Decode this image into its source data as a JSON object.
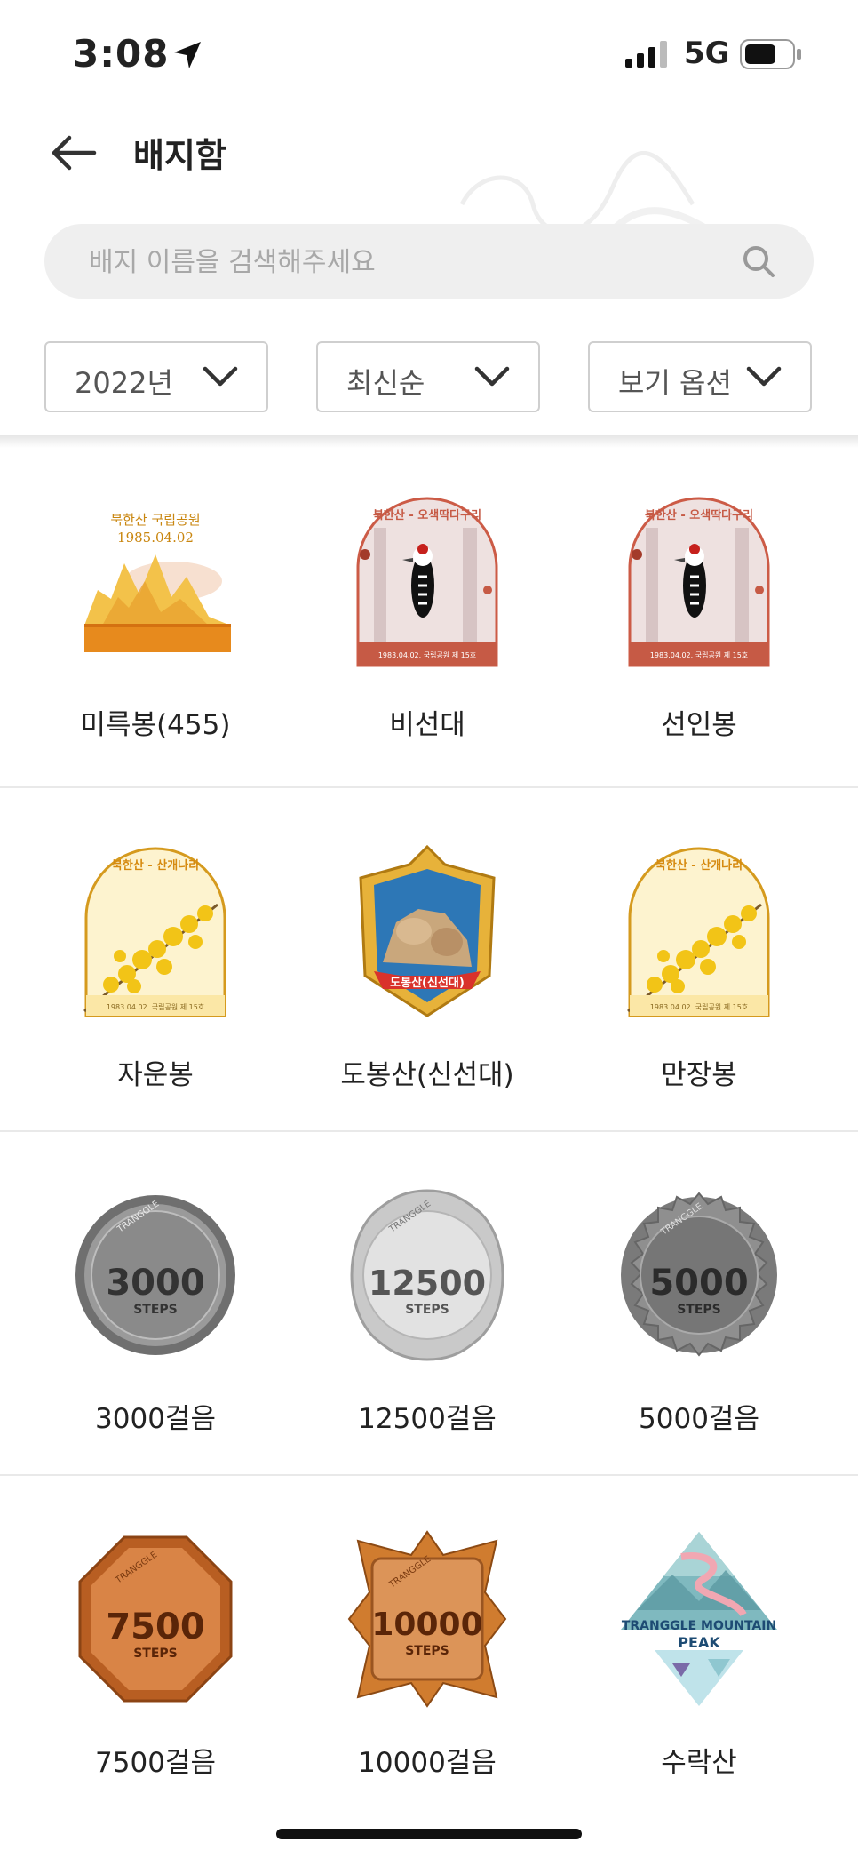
{
  "status": {
    "time": "3:08",
    "network": "5G"
  },
  "header": {
    "title": "배지함"
  },
  "search": {
    "placeholder": "배지 이름을 검색해주세요"
  },
  "filters": [
    {
      "label": "2022년"
    },
    {
      "label": "최신순"
    },
    {
      "label": "보기 옵션"
    }
  ],
  "badges": [
    {
      "name": "미륵봉(455)",
      "art": "bukhansan-gold",
      "caption": "북한산 국립공원",
      "date": "1985.04.02"
    },
    {
      "name": "비선대",
      "art": "woodpecker",
      "caption": "북한산 - 오색딱다구리",
      "date": "1983.04.02. 국립공원 제 15호"
    },
    {
      "name": "선인봉",
      "art": "woodpecker",
      "caption": "북한산 - 오색딱다구리",
      "date": "1983.04.02. 국립공원 제 15호"
    },
    {
      "name": "자운봉",
      "art": "forsythia",
      "caption": "북한산 - 산개나리",
      "date": "1983.04.02. 국립공원 제 15호"
    },
    {
      "name": "도봉산(신선대)",
      "art": "dobongsan-shield",
      "caption": "도봉산(신선대)"
    },
    {
      "name": "만장봉",
      "art": "forsythia",
      "caption": "북한산 - 산개나리",
      "date": "1983.04.02. 국립공원 제 15호"
    },
    {
      "name": "3000걸음",
      "art": "steps-silver-dark",
      "caption": "3000",
      "sub": "STEPS",
      "brand": "TRANGGLE"
    },
    {
      "name": "12500걸음",
      "art": "steps-silver-light",
      "caption": "12500",
      "sub": "STEPS",
      "brand": "TRANGGLE"
    },
    {
      "name": "5000걸음",
      "art": "steps-silver-cap",
      "caption": "5000",
      "sub": "STEPS",
      "brand": "TRANGGLE"
    },
    {
      "name": "7500걸음",
      "art": "steps-bronze-octagon",
      "caption": "7500",
      "sub": "STEPS",
      "brand": "TRANGGLE"
    },
    {
      "name": "10000걸음",
      "art": "steps-bronze-star",
      "caption": "10000",
      "sub": "STEPS",
      "brand": "TRANGGLE"
    },
    {
      "name": "수락산",
      "art": "tranggle-mountain-peak",
      "caption": "TRANGGLE MOUNTAIN",
      "sub": "PEAK"
    }
  ],
  "colors": {
    "accent": "#e0a335",
    "bronze": "#c8702e",
    "silver": "#8a8a8a",
    "woodpecker_red": "#c65a45"
  }
}
